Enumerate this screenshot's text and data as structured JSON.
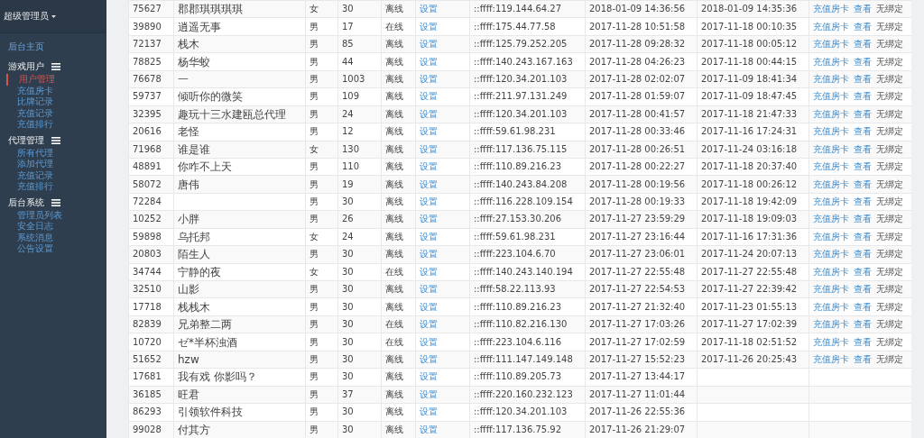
{
  "sidebar": {
    "user": "超级管理员",
    "home": "后台主页",
    "sections": [
      {
        "title": "游戏用户",
        "items": [
          {
            "label": "用户管理",
            "selected": true
          },
          {
            "label": "充值房卡",
            "selected": false
          },
          {
            "label": "比牌记录",
            "selected": false
          },
          {
            "label": "充值记录",
            "selected": false
          },
          {
            "label": "充值排行",
            "selected": false
          }
        ]
      },
      {
        "title": "代理管理",
        "items": [
          {
            "label": "所有代理",
            "selected": false
          },
          {
            "label": "添加代理",
            "selected": false
          },
          {
            "label": "充值记录",
            "selected": false
          },
          {
            "label": "充值排行",
            "selected": false
          }
        ]
      },
      {
        "title": "后台系统",
        "items": [
          {
            "label": "管理员列表",
            "selected": false
          },
          {
            "label": "安全日志",
            "selected": false
          },
          {
            "label": "系统消息",
            "selected": false
          },
          {
            "label": "公告设置",
            "selected": false
          }
        ]
      }
    ]
  },
  "table": {
    "rows": [
      {
        "id": "75627",
        "name": "郡郡琪琪琪琪",
        "gender": "女",
        "level": "30",
        "status": "离线",
        "setting": "设置",
        "ip": "::ffff:119.144.64.27",
        "registered": "2018-01-09 14:36:56",
        "last_login": "2018-01-09 14:35:36",
        "actions": [
          "充值房卡",
          "查看",
          "无绑定"
        ]
      },
      {
        "id": "39890",
        "name": "逍遥无事",
        "gender": "男",
        "level": "17",
        "status": "在线",
        "setting": "设置",
        "ip": "::ffff:175.44.77.58",
        "registered": "2017-11-28 10:51:58",
        "last_login": "2017-11-18 00:10:35",
        "actions": [
          "充值房卡",
          "查看",
          "无绑定"
        ]
      },
      {
        "id": "72137",
        "name": "栈木",
        "gender": "男",
        "level": "85",
        "status": "离线",
        "setting": "设置",
        "ip": "::ffff:125.79.252.205",
        "registered": "2017-11-28 09:28:32",
        "last_login": "2017-11-18 00:05:12",
        "actions": [
          "充值房卡",
          "查看",
          "无绑定"
        ]
      },
      {
        "id": "78825",
        "name": "杨华蛟",
        "gender": "男",
        "level": "44",
        "status": "离线",
        "setting": "设置",
        "ip": "::ffff:140.243.167.163",
        "registered": "2017-11-28 04:26:23",
        "last_login": "2017-11-18 00:44:15",
        "actions": [
          "充值房卡",
          "查看",
          "无绑定"
        ]
      },
      {
        "id": "76678",
        "name": "一",
        "gender": "男",
        "level": "1003",
        "status": "离线",
        "setting": "设置",
        "ip": "::ffff:120.34.201.103",
        "registered": "2017-11-28 02:02:07",
        "last_login": "2017-11-09 18:41:34",
        "actions": [
          "充值房卡",
          "查看",
          "无绑定"
        ]
      },
      {
        "id": "59737",
        "name": "倾听你的微笑",
        "gender": "男",
        "level": "109",
        "status": "离线",
        "setting": "设置",
        "ip": "::ffff:211.97.131.249",
        "registered": "2017-11-28 01:59:07",
        "last_login": "2017-11-09 18:47:45",
        "actions": [
          "充值房卡",
          "查看",
          "无绑定"
        ]
      },
      {
        "id": "32395",
        "name": "趣玩十三水建瓯总代理",
        "gender": "男",
        "level": "24",
        "status": "离线",
        "setting": "设置",
        "ip": "::ffff:120.34.201.103",
        "registered": "2017-11-28 00:41:57",
        "last_login": "2017-11-18 21:47:33",
        "actions": [
          "充值房卡",
          "查看",
          "无绑定"
        ]
      },
      {
        "id": "20616",
        "name": "老怪",
        "gender": "男",
        "level": "12",
        "status": "离线",
        "setting": "设置",
        "ip": "::ffff:59.61.98.231",
        "registered": "2017-11-28 00:33:46",
        "last_login": "2017-11-16 17:24:31",
        "actions": [
          "充值房卡",
          "查看",
          "无绑定"
        ]
      },
      {
        "id": "71968",
        "name": "谁是谁",
        "gender": "女",
        "level": "130",
        "status": "离线",
        "setting": "设置",
        "ip": "::ffff:117.136.75.115",
        "registered": "2017-11-28 00:26:51",
        "last_login": "2017-11-24 03:16:18",
        "actions": [
          "充值房卡",
          "查看",
          "无绑定"
        ]
      },
      {
        "id": "48891",
        "name": "你咋不上天",
        "gender": "男",
        "level": "110",
        "status": "离线",
        "setting": "设置",
        "ip": "::ffff:110.89.216.23",
        "registered": "2017-11-28 00:22:27",
        "last_login": "2017-11-18 20:37:40",
        "actions": [
          "充值房卡",
          "查看",
          "无绑定"
        ]
      },
      {
        "id": "58072",
        "name": "唐伟",
        "gender": "男",
        "level": "19",
        "status": "离线",
        "setting": "设置",
        "ip": "::ffff:140.243.84.208",
        "registered": "2017-11-28 00:19:56",
        "last_login": "2017-11-18 00:26:12",
        "actions": [
          "充值房卡",
          "查看",
          "无绑定"
        ]
      },
      {
        "id": "72284",
        "gender": "男",
        "level": "30",
        "status": "离线",
        "setting": "设置",
        "ip": "::ffff:116.228.109.154",
        "registered": "2017-11-28 00:19:33",
        "last_login": "2017-11-18 19:42:09",
        "actions": [
          "充值房卡",
          "查看",
          "无绑定"
        ]
      },
      {
        "id": "10252",
        "name": "小胖",
        "gender": "男",
        "level": "26",
        "status": "离线",
        "setting": "设置",
        "ip": "::ffff:27.153.30.206",
        "registered": "2017-11-27 23:59:29",
        "last_login": "2017-11-18 19:09:03",
        "actions": [
          "充值房卡",
          "查看",
          "无绑定"
        ]
      },
      {
        "id": "59898",
        "name": "乌托邦",
        "gender": "女",
        "level": "24",
        "status": "离线",
        "setting": "设置",
        "ip": "::ffff:59.61.98.231",
        "registered": "2017-11-27 23:16:44",
        "last_login": "2017-11-16 17:31:36",
        "actions": [
          "充值房卡",
          "查看",
          "无绑定"
        ]
      },
      {
        "id": "20803",
        "name": "陌生人",
        "gender": "男",
        "level": "30",
        "status": "离线",
        "setting": "设置",
        "ip": "::ffff:223.104.6.70",
        "registered": "2017-11-27 23:06:01",
        "last_login": "2017-11-24 20:07:13",
        "actions": [
          "充值房卡",
          "查看",
          "无绑定"
        ]
      },
      {
        "id": "34744",
        "name": "宁静的夜",
        "gender": "女",
        "level": "30",
        "status": "在线",
        "setting": "设置",
        "ip": "::ffff:140.243.140.194",
        "registered": "2017-11-27 22:55:48",
        "last_login": "2017-11-27 22:55:48",
        "actions": [
          "充值房卡",
          "查看",
          "无绑定"
        ]
      },
      {
        "id": "32510",
        "name": "山影",
        "gender": "男",
        "level": "30",
        "status": "离线",
        "setting": "设置",
        "ip": "::ffff:58.22.113.93",
        "registered": "2017-11-27 22:54:53",
        "last_login": "2017-11-27 22:39:42",
        "actions": [
          "充值房卡",
          "查看",
          "无绑定"
        ]
      },
      {
        "id": "17718",
        "name": "栈栈木",
        "gender": "男",
        "level": "30",
        "status": "离线",
        "setting": "设置",
        "ip": "::ffff:110.89.216.23",
        "registered": "2017-11-27 21:32:40",
        "last_login": "2017-11-23 01:55:13",
        "actions": [
          "充值房卡",
          "查看",
          "无绑定"
        ]
      },
      {
        "id": "82839",
        "name": "兄弟整二两",
        "gender": "男",
        "level": "30",
        "status": "在线",
        "setting": "设置",
        "ip": "::ffff:110.82.216.130",
        "registered": "2017-11-27 17:03:26",
        "last_login": "2017-11-27 17:02:39",
        "actions": [
          "充值房卡",
          "查看",
          "无绑定"
        ]
      },
      {
        "id": "10720",
        "name": "ゼ*半杯浊酒",
        "gender": "男",
        "level": "30",
        "status": "在线",
        "setting": "设置",
        "ip": "::ffff:223.104.6.116",
        "registered": "2017-11-27 17:02:59",
        "last_login": "2017-11-18 02:51:52",
        "actions": [
          "充值房卡",
          "查看",
          "无绑定"
        ]
      },
      {
        "id": "51652",
        "name": "hzw",
        "gender": "男",
        "level": "30",
        "status": "离线",
        "setting": "设置",
        "ip": "::ffff:111.147.149.148",
        "registered": "2017-11-27 15:52:23",
        "last_login": "2017-11-26 20:25:43",
        "actions": [
          "充值房卡",
          "查看",
          "无绑定"
        ]
      },
      {
        "id": "17681",
        "name": "我有戏 你影吗？",
        "gender": "男",
        "level": "30",
        "status": "离线",
        "setting": "设置",
        "ip": "::ffff:110.89.205.73",
        "registered": "2017-11-27 13:44:17"
      },
      {
        "id": "36185",
        "name": "旺君",
        "gender": "男",
        "level": "37",
        "status": "离线",
        "setting": "设置",
        "ip": "::ffff:220.160.232.123",
        "registered": "2017-11-27 11:01:44"
      },
      {
        "id": "86293",
        "name": "引领软件科技",
        "gender": "男",
        "level": "30",
        "status": "离线",
        "setting": "设置",
        "ip": "::ffff:120.34.201.103",
        "registered": "2017-11-26 22:55:36"
      },
      {
        "id": "99028",
        "name": "付其方",
        "gender": "男",
        "level": "30",
        "status": "离线",
        "setting": "设置",
        "ip": "::ffff:117.136.75.92",
        "registered": "2017-11-26 21:29:07"
      }
    ]
  }
}
